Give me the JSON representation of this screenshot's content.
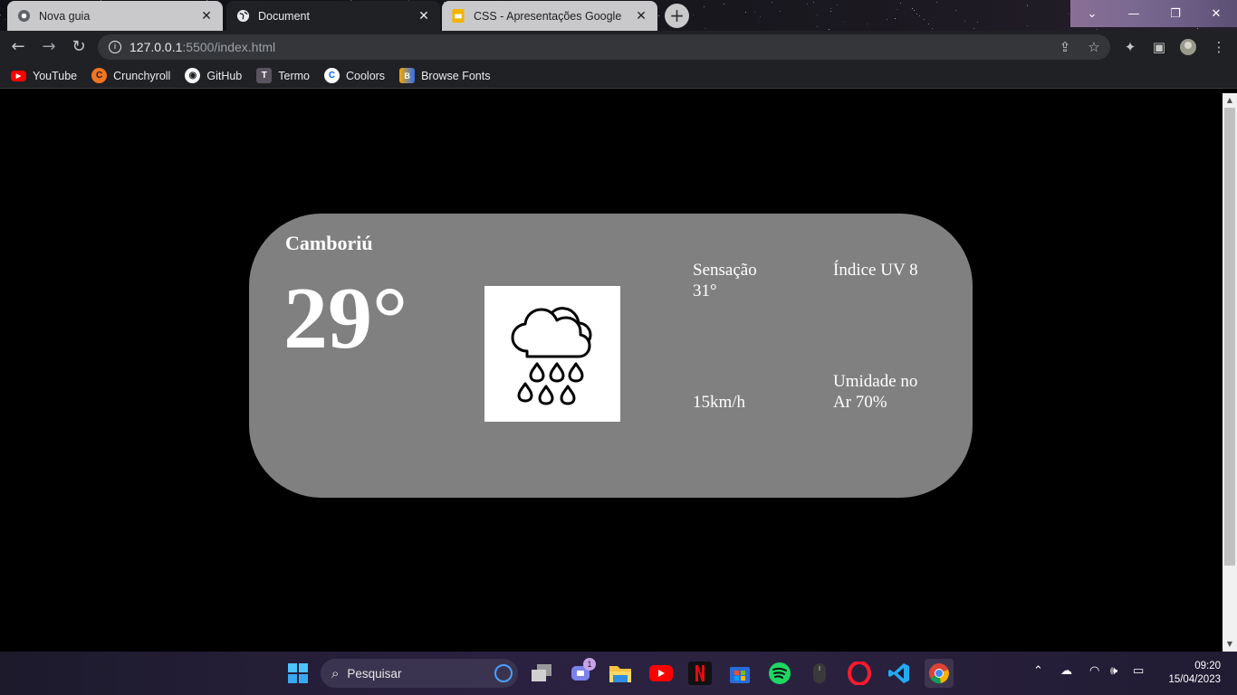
{
  "browser": {
    "tabs": [
      {
        "title": "Nova guia",
        "state": "inactive"
      },
      {
        "title": "Document",
        "state": "active"
      },
      {
        "title": "CSS - Apresentações Google",
        "state": "inactive"
      }
    ],
    "address": {
      "host": "127.0.0.1",
      "path": ":5500/index.html"
    },
    "bookmarks": [
      {
        "label": "YouTube",
        "icon": "youtube-icon",
        "color": "#ff0000"
      },
      {
        "label": "Crunchyroll",
        "icon": "crunchyroll-icon",
        "color": "#f47521"
      },
      {
        "label": "GitHub",
        "icon": "github-icon",
        "color": "#ffffff"
      },
      {
        "label": "Termo",
        "icon": "termo-icon",
        "color": "#5a5360"
      },
      {
        "label": "Coolors",
        "icon": "coolors-icon",
        "color": "#0066ff"
      },
      {
        "label": "Browse Fonts",
        "icon": "browse-fonts-icon",
        "color": "#2b6df6"
      }
    ]
  },
  "weather": {
    "city": "Camboriú",
    "temperature": "29°",
    "icon": "cloud-rain-icon",
    "feels_like_label": "Sensação",
    "feels_like_value": "31°",
    "uv_label": "Índice UV 8",
    "wind": "15km/h",
    "humidity_line1": "Umidade no",
    "humidity_line2": "Ar 70%",
    "card_color": "#808080"
  },
  "taskbar": {
    "search_placeholder": "Pesquisar",
    "time": "09:20",
    "date": "15/04/2023",
    "teams_badge": "1"
  }
}
